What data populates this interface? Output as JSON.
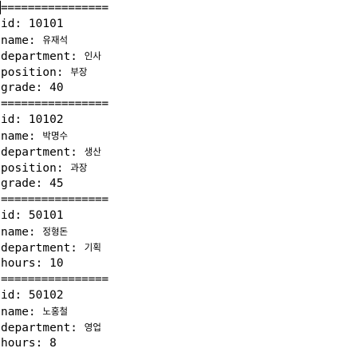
{
  "separator": "================",
  "records": [
    {
      "lines": [
        {
          "key": "id: ",
          "value": "10101",
          "korean": false
        },
        {
          "key": "name: ",
          "value": "유재석",
          "korean": true
        },
        {
          "key": "department: ",
          "value": "인사",
          "korean": true
        },
        {
          "key": "position: ",
          "value": "부장",
          "korean": true
        },
        {
          "key": "grade: ",
          "value": "40",
          "korean": false
        }
      ]
    },
    {
      "lines": [
        {
          "key": "id: ",
          "value": "10102",
          "korean": false
        },
        {
          "key": "name: ",
          "value": "박명수",
          "korean": true
        },
        {
          "key": "department: ",
          "value": "생산",
          "korean": true
        },
        {
          "key": "position: ",
          "value": "과장",
          "korean": true
        },
        {
          "key": "grade: ",
          "value": "45",
          "korean": false
        }
      ]
    },
    {
      "lines": [
        {
          "key": "id: ",
          "value": "50101",
          "korean": false
        },
        {
          "key": "name: ",
          "value": "정형돈",
          "korean": true
        },
        {
          "key": "department: ",
          "value": "기획",
          "korean": true
        },
        {
          "key": "hours: ",
          "value": "10",
          "korean": false
        }
      ]
    },
    {
      "lines": [
        {
          "key": "id: ",
          "value": "50102",
          "korean": false
        },
        {
          "key": "name: ",
          "value": "노홍철",
          "korean": true
        },
        {
          "key": "department: ",
          "value": "영업",
          "korean": true
        },
        {
          "key": "hours: ",
          "value": "8",
          "korean": false
        }
      ]
    }
  ]
}
